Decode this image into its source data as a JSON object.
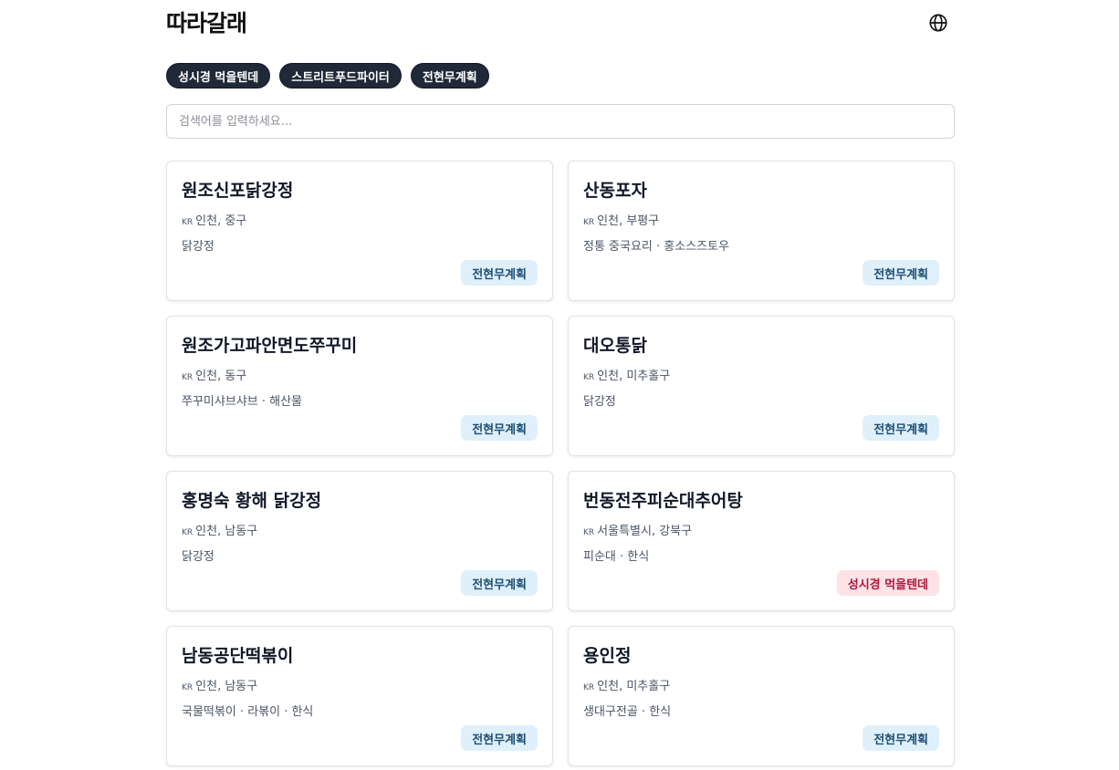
{
  "header": {
    "logo": "따라갈래",
    "language_icon": "globe-icon"
  },
  "filters": [
    {
      "label": "성시경 먹을텐데"
    },
    {
      "label": "스트리트푸드파이터"
    },
    {
      "label": "전현무계획"
    }
  ],
  "search": {
    "placeholder": "검색어를 입력하세요...",
    "value": ""
  },
  "colors": {
    "chip_bg": "#1f2937",
    "tag_blue_bg": "#dff0fb",
    "tag_blue_text": "#1d4e73",
    "tag_pink_bg": "#fde2e6",
    "tag_pink_text": "#b0183a"
  },
  "restaurants": [
    {
      "name": "원조신포닭강정",
      "country": "KR",
      "location": "인천, 중구",
      "category": "닭강정",
      "show": "전현무계획",
      "tag_style": "blue"
    },
    {
      "name": "산동포자",
      "country": "KR",
      "location": "인천, 부평구",
      "category": "정통 중국요리 · 홍소스즈토우",
      "show": "전현무계획",
      "tag_style": "blue"
    },
    {
      "name": "원조가고파안면도쭈꾸미",
      "country": "KR",
      "location": "인천, 동구",
      "category": "쭈꾸미샤브샤브 · 해산물",
      "show": "전현무계획",
      "tag_style": "blue"
    },
    {
      "name": "대오통닭",
      "country": "KR",
      "location": "인천, 미추홀구",
      "category": "닭강정",
      "show": "전현무계획",
      "tag_style": "blue"
    },
    {
      "name": "홍명숙 황해 닭강정",
      "country": "KR",
      "location": "인천, 남동구",
      "category": "닭강정",
      "show": "전현무계획",
      "tag_style": "blue"
    },
    {
      "name": "번동전주피순대추어탕",
      "country": "KR",
      "location": "서울특별시, 강북구",
      "category": "피순대 · 한식",
      "show": "성시경 먹을텐데",
      "tag_style": "pink"
    },
    {
      "name": "남동공단떡볶이",
      "country": "KR",
      "location": "인천, 남동구",
      "category": "국물떡볶이 · 라볶이 · 한식",
      "show": "전현무계획",
      "tag_style": "blue"
    },
    {
      "name": "용인정",
      "country": "KR",
      "location": "인천, 미추홀구",
      "category": "생대구전골 · 한식",
      "show": "전현무계획",
      "tag_style": "blue"
    }
  ]
}
